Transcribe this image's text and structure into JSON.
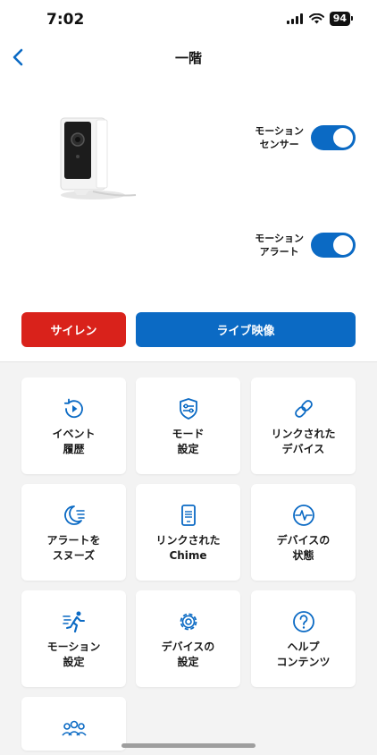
{
  "status_bar": {
    "time": "7:02",
    "battery": "94"
  },
  "header": {
    "title": "一階"
  },
  "toggles": [
    {
      "label": "モーション\nセンサー",
      "state": "on"
    },
    {
      "label": "モーション\nアラート",
      "state": "on"
    }
  ],
  "actions": {
    "siren_label": "サイレン",
    "live_label": "ライブ映像"
  },
  "tiles": [
    {
      "label": "イベント\n履歴",
      "icon": "event-history-icon"
    },
    {
      "label": "モード\n設定",
      "icon": "mode-settings-icon"
    },
    {
      "label": "リンクされた\nデバイス",
      "icon": "link-icon"
    },
    {
      "label": "アラートを\nスヌーズ",
      "icon": "snooze-moon-icon"
    },
    {
      "label": "リンクされた\nChime",
      "icon": "chime-icon"
    },
    {
      "label": "デバイスの\n状態",
      "icon": "device-health-icon"
    },
    {
      "label": "モーション\n設定",
      "icon": "motion-runner-icon"
    },
    {
      "label": "デバイスの\n設定",
      "icon": "gear-icon"
    },
    {
      "label": "ヘルプ\nコンテンツ",
      "icon": "help-icon"
    }
  ],
  "colors": {
    "accent": "#0b6ac4",
    "siren": "#d9221b",
    "grid_bg": "#f3f3f3"
  }
}
